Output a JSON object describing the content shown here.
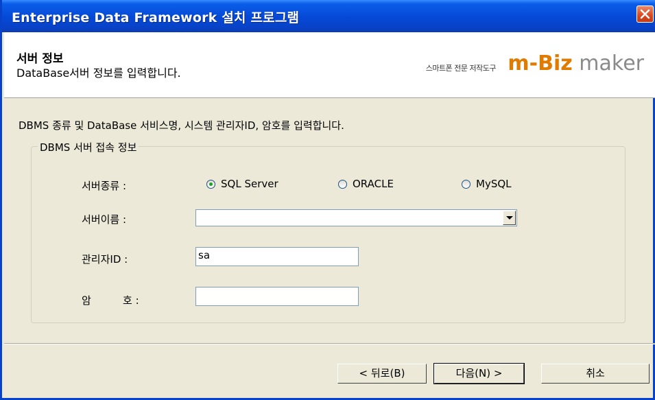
{
  "window": {
    "title": "Enterprise Data Framework 설치 프로그램",
    "close_icon": "close-icon"
  },
  "header": {
    "title": "서버 정보",
    "subtitle": "DataBase서버 정보를 입력합니다.",
    "logo": {
      "tagline": "스마트폰 전문 저작도구",
      "brand_m": "m",
      "brand_dash": "-",
      "brand_biz": "Biz",
      "brand_maker": " maker"
    }
  },
  "body": {
    "description": "DBMS 종류 및 DataBase 서비스명, 시스템 관리자ID, 암호를 입력합니다.",
    "group_label": "DBMS 서버 접속 정보",
    "server_type_label": "서버종류 :",
    "server_name_label": "서버이름 :",
    "admin_id_label": "관리자ID :",
    "password_label_a": "암",
    "password_label_b": "호 :",
    "server_types": [
      {
        "label": "SQL Server",
        "selected": true
      },
      {
        "label": "ORACLE",
        "selected": false
      },
      {
        "label": "MySQL",
        "selected": false
      }
    ],
    "server_name_value": "",
    "admin_id_value": "sa",
    "password_value": ""
  },
  "buttons": {
    "back": "< 뒤로(B)",
    "next": "다음(N) >",
    "cancel": "취소"
  },
  "colors": {
    "accent": "#0842c8",
    "brand": "#e07b00"
  }
}
